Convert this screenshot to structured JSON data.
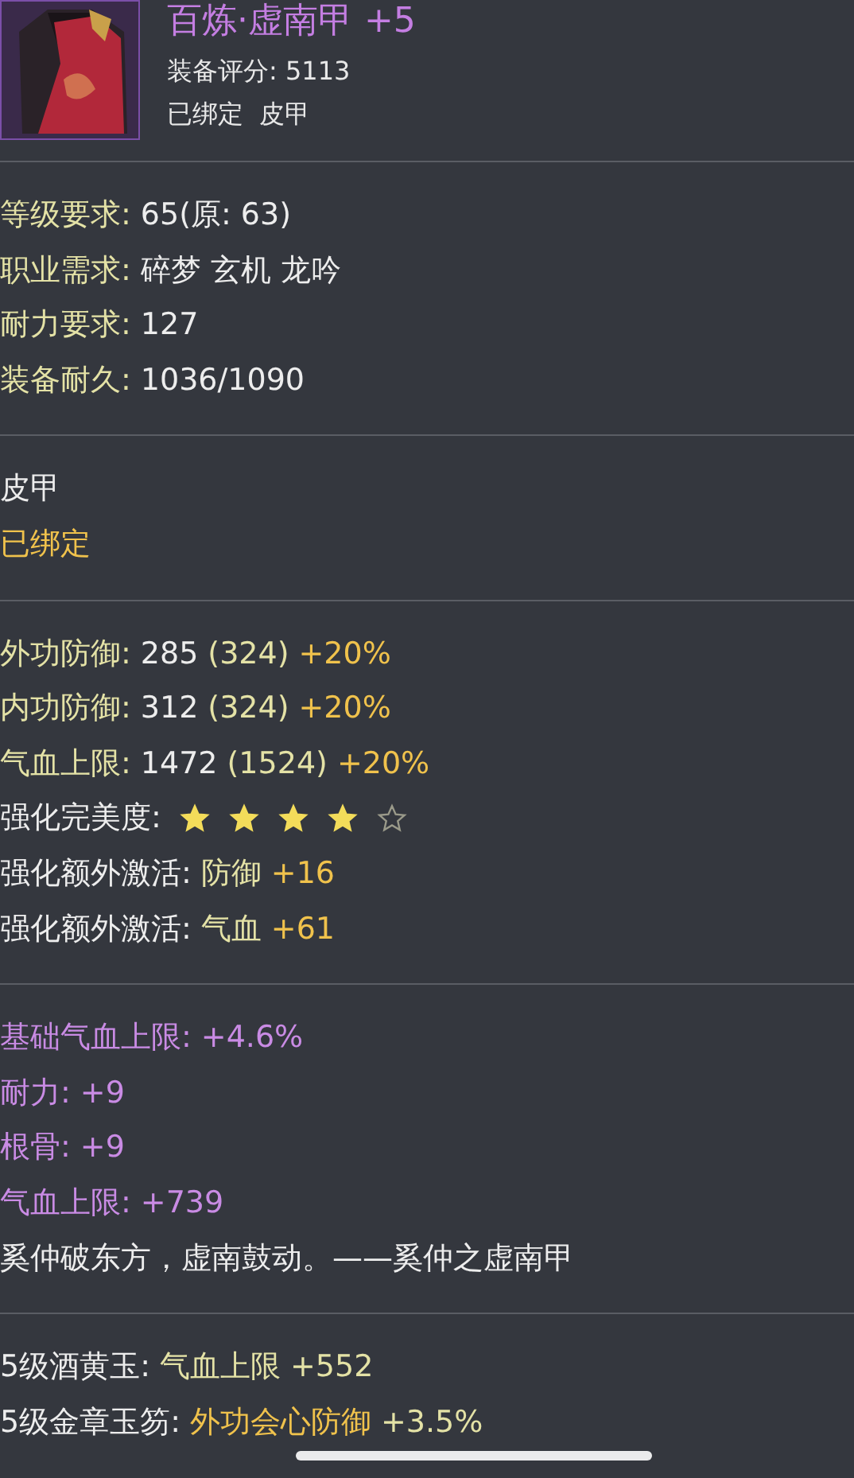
{
  "item": {
    "name": "百炼·虚南甲 +5",
    "score": "装备评分: 5113",
    "tags": "已绑定  皮甲"
  },
  "sections": [
    {
      "lines": [
        {
          "segments": [
            {
              "kind": "label",
              "text": "等级要求:"
            },
            {
              "kind": "value",
              "text": "65(原: 63)"
            }
          ]
        },
        {
          "segments": [
            {
              "kind": "label",
              "text": "职业需求:"
            },
            {
              "kind": "value",
              "text": "碎梦 玄机 龙吟"
            }
          ]
        },
        {
          "segments": [
            {
              "kind": "label",
              "text": "耐力要求:"
            },
            {
              "kind": "value",
              "text": "127"
            }
          ]
        },
        {
          "segments": [
            {
              "kind": "label",
              "text": "装备耐久:"
            },
            {
              "kind": "value",
              "text": "1036/1090"
            }
          ]
        }
      ]
    },
    {
      "lines": [
        {
          "segments": [
            {
              "kind": "value",
              "text": "皮甲"
            }
          ]
        },
        {
          "segments": [
            {
              "kind": "bonus",
              "text": "已绑定"
            }
          ]
        }
      ]
    },
    {
      "lines": [
        {
          "segments": [
            {
              "kind": "label",
              "text": "外功防御:"
            },
            {
              "kind": "value",
              "text": "285"
            },
            {
              "kind": "label",
              "text": "(324)"
            },
            {
              "kind": "bonus",
              "text": "+20%"
            }
          ]
        },
        {
          "segments": [
            {
              "kind": "label",
              "text": "内功防御:"
            },
            {
              "kind": "value",
              "text": "312"
            },
            {
              "kind": "label",
              "text": "(324)"
            },
            {
              "kind": "bonus",
              "text": "+20%"
            }
          ]
        },
        {
          "segments": [
            {
              "kind": "label",
              "text": "气血上限:"
            },
            {
              "kind": "value",
              "text": "1472"
            },
            {
              "kind": "label",
              "text": "(1524)"
            },
            {
              "kind": "bonus",
              "text": "+20%"
            }
          ]
        },
        {
          "segments": [
            {
              "kind": "value",
              "text": "强化完美度:"
            }
          ],
          "stars": 4
        },
        {
          "segments": [
            {
              "kind": "value",
              "text": "强化额外激活:"
            },
            {
              "kind": "label",
              "text": "防御"
            },
            {
              "kind": "bonus",
              "text": "+16"
            }
          ]
        },
        {
          "segments": [
            {
              "kind": "value",
              "text": "强化额外激活:"
            },
            {
              "kind": "label",
              "text": "气血"
            },
            {
              "kind": "bonus",
              "text": "+61"
            }
          ]
        }
      ]
    },
    {
      "lines": [
        {
          "segments": [
            {
              "kind": "purple",
              "text": "基础气血上限:"
            },
            {
              "kind": "purple",
              "text": "+4.6%"
            }
          ]
        },
        {
          "segments": [
            {
              "kind": "purple",
              "text": "耐力:"
            },
            {
              "kind": "purple",
              "text": "+9"
            }
          ]
        },
        {
          "segments": [
            {
              "kind": "purple",
              "text": "根骨:"
            },
            {
              "kind": "purple",
              "text": "+9"
            }
          ]
        },
        {
          "segments": [
            {
              "kind": "purple",
              "text": "气血上限:"
            },
            {
              "kind": "purple",
              "text": "+739"
            }
          ]
        },
        {
          "segments": [
            {
              "kind": "value",
              "text": "奚仲破东方，虚南鼓动。——奚仲之虚南甲"
            }
          ]
        }
      ]
    },
    {
      "lines": [
        {
          "segments": [
            {
              "kind": "value",
              "text": "5级酒黄玉:"
            },
            {
              "kind": "label",
              "text": "气血上限"
            },
            {
              "kind": "label",
              "text": "+552"
            }
          ]
        },
        {
          "segments": [
            {
              "kind": "value",
              "text": "5级金章玉笏:"
            },
            {
              "kind": "bonus",
              "text": "外功会心防御"
            },
            {
              "kind": "label",
              "text": "+3.5%"
            }
          ]
        }
      ]
    }
  ]
}
